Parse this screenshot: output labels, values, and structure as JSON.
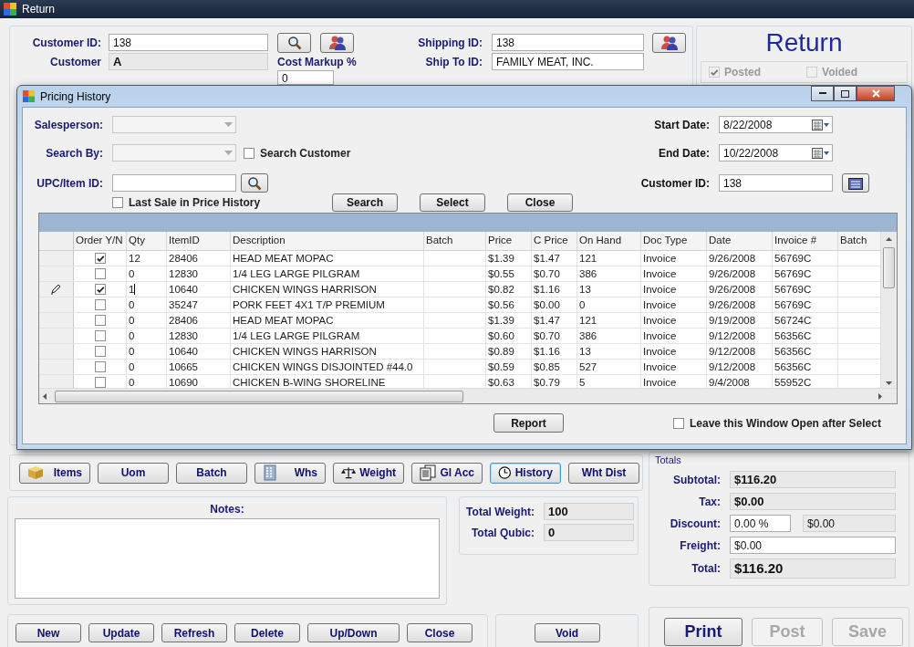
{
  "window": {
    "title": "Return"
  },
  "customer": {
    "fields": [
      {
        "label": "Customer ID:",
        "value": "138",
        "kind": "input"
      },
      {
        "label": "Customer",
        "value": "A",
        "kind": "readonly"
      }
    ]
  },
  "cost_markup": {
    "label": "Cost Markup %",
    "value": "0"
  },
  "shipping": {
    "fields": [
      {
        "label": "Shipping ID:",
        "value": "138",
        "kind": "input"
      },
      {
        "label": "Ship To ID:",
        "value": "FAMILY MEAT, INC.",
        "kind": "input"
      }
    ]
  },
  "document": {
    "title": "Return",
    "flags": [
      {
        "label": "Posted",
        "checked": true,
        "disabled": true
      },
      {
        "label": "Voided",
        "checked": false,
        "disabled": true
      }
    ]
  },
  "dialog": {
    "title": "Pricing History",
    "salesperson": {
      "label": "Salesperson:",
      "disabled": true
    },
    "search_by": {
      "label": "Search By:",
      "disabled": true
    },
    "search_customer": {
      "label": "Search Customer",
      "checked": false
    },
    "upc": {
      "label": "UPC/Item ID:"
    },
    "last_sale": {
      "label": "Last Sale in Price History",
      "checked": false
    },
    "buttons": [
      "Search",
      "Select",
      "Close"
    ],
    "start_date": {
      "label": "Start Date:",
      "value": "8/22/2008"
    },
    "end_date": {
      "label": "End  Date:",
      "value": "10/22/2008"
    },
    "customer_id": {
      "label": "Customer ID:",
      "value": "138"
    },
    "grid": {
      "columns": [
        "Order Y/N",
        "Qty",
        "ItemID",
        "Description",
        "Batch",
        "Price",
        "C Price",
        "On Hand",
        "Doc Type",
        "Date",
        "Invoice #",
        "Batch"
      ],
      "rows": [
        {
          "editing": false,
          "order": true,
          "qty": "12",
          "item_id": "28406",
          "description": "HEAD MEAT MOPAC",
          "price": "$1.39",
          "c_price": "$1.47",
          "on_hand": "121",
          "doc_type": "Invoice",
          "date": "9/26/2008",
          "invoice": "56769C"
        },
        {
          "editing": false,
          "order": false,
          "qty": "0",
          "item_id": "12830",
          "description": "1/4 LEG  LARGE PILGRAM",
          "price": "$0.55",
          "c_price": "$0.70",
          "on_hand": "386",
          "doc_type": "Invoice",
          "date": "9/26/2008",
          "invoice": "56769C"
        },
        {
          "editing": true,
          "order": true,
          "qty": "1",
          "item_id": "10640",
          "description": "CHICKEN WINGS HARRISON",
          "price": "$0.82",
          "c_price": "$1.16",
          "on_hand": "13",
          "doc_type": "Invoice",
          "date": "9/26/2008",
          "invoice": "56769C"
        },
        {
          "editing": false,
          "order": false,
          "qty": "0",
          "item_id": "35247",
          "description": "PORK FEET 4X1 T/P PREMIUM",
          "price": "$0.56",
          "c_price": "$0.00",
          "on_hand": "0",
          "doc_type": "Invoice",
          "date": "9/26/2008",
          "invoice": "56769C"
        },
        {
          "editing": false,
          "order": false,
          "qty": "0",
          "item_id": "28406",
          "description": "HEAD MEAT MOPAC",
          "price": "$1.39",
          "c_price": "$1.47",
          "on_hand": "121",
          "doc_type": "Invoice",
          "date": "9/19/2008",
          "invoice": "56724C"
        },
        {
          "editing": false,
          "order": false,
          "qty": "0",
          "item_id": "12830",
          "description": "1/4 LEG  LARGE PILGRAM",
          "price": "$0.60",
          "c_price": "$0.70",
          "on_hand": "386",
          "doc_type": "Invoice",
          "date": "9/12/2008",
          "invoice": "56356C"
        },
        {
          "editing": false,
          "order": false,
          "qty": "0",
          "item_id": "10640",
          "description": "CHICKEN WINGS HARRISON",
          "price": "$0.89",
          "c_price": "$1.16",
          "on_hand": "13",
          "doc_type": "Invoice",
          "date": "9/12/2008",
          "invoice": "56356C"
        },
        {
          "editing": false,
          "order": false,
          "qty": "0",
          "item_id": "10665",
          "description": "CHICKEN WINGS DISJOINTED #44.0",
          "price": "$0.59",
          "c_price": "$0.85",
          "on_hand": "527",
          "doc_type": "Invoice",
          "date": "9/12/2008",
          "invoice": "56356C"
        },
        {
          "editing": false,
          "order": false,
          "qty": "0",
          "item_id": "10690",
          "description": "CHICKEN B-WING SHORELINE",
          "price": "$0.63",
          "c_price": "$0.79",
          "on_hand": "5",
          "doc_type": "Invoice",
          "date": "9/4/2008",
          "invoice": "55952C"
        }
      ]
    },
    "report_button": "Report",
    "leave_open": {
      "label": "Leave this Window Open after Select",
      "checked": false
    }
  },
  "toolbar": [
    {
      "label": "Items",
      "kind": "box",
      "focused": false
    },
    {
      "label": "Uom",
      "kind": "plain",
      "focused": false
    },
    {
      "label": "Batch",
      "kind": "plain",
      "focused": false
    },
    {
      "label": "Whs",
      "kind": "building",
      "focused": false
    },
    {
      "label": "Weight",
      "kind": "scale",
      "focused": false
    },
    {
      "label": "Gl Acc",
      "kind": "documents",
      "focused": false
    },
    {
      "label": "History",
      "kind": "clock",
      "focused": true
    },
    {
      "label": "Wht Dist",
      "kind": "plain",
      "focused": false
    }
  ],
  "notes": {
    "label": "Notes:"
  },
  "weights": [
    {
      "label": "Total Weight:",
      "value": "100"
    },
    {
      "label": "Total Qubic:",
      "value": "0"
    }
  ],
  "actions": [
    "New",
    "Update",
    "Refresh",
    "Delete",
    "Up/Down",
    "Close"
  ],
  "void_button": "Void",
  "totals": {
    "legend": "Totals",
    "rows": [
      {
        "label": "Subtotal:",
        "value": "$116.20",
        "kind": "readonly"
      },
      {
        "label": "Tax:",
        "value": "$0.00",
        "kind": "readonly"
      },
      {
        "label": "Discount:",
        "value": "0.00 %",
        "extra": "$0.00",
        "kind": "split"
      },
      {
        "label": "Freight:",
        "value": "$0.00",
        "kind": "input"
      },
      {
        "label": "Total:",
        "value": "$116.20",
        "kind": "total"
      }
    ]
  },
  "final_buttons": [
    {
      "label": "Print",
      "disabled": false
    },
    {
      "label": "Post",
      "disabled": true
    },
    {
      "label": "Save",
      "disabled": true
    }
  ]
}
